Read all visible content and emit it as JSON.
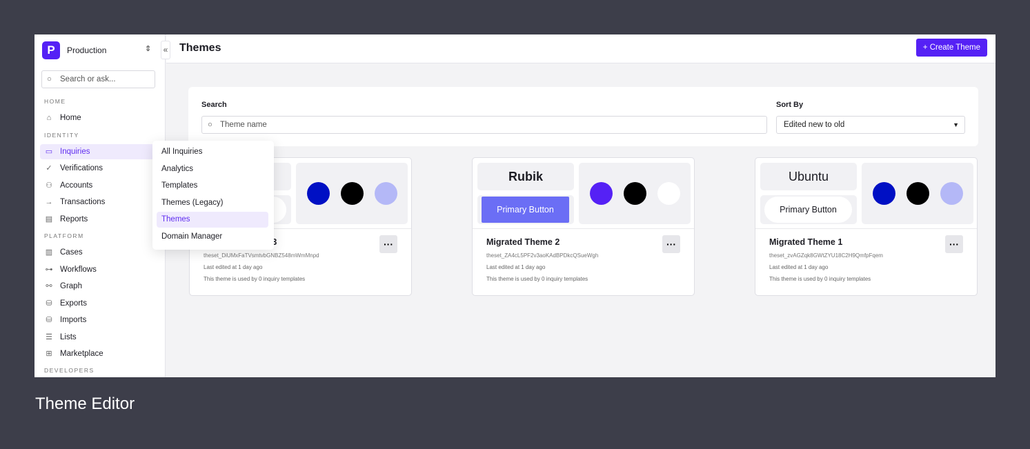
{
  "sidebar": {
    "org": "Production",
    "logo": "P",
    "search_placeholder": "Search or ask...",
    "sections": {
      "home": "HOME",
      "identity": "IDENTITY",
      "platform": "PLATFORM",
      "developers": "DEVELOPERS"
    },
    "items": [
      {
        "label": "Home",
        "icon": "home-icon"
      },
      {
        "label": "Inquiries",
        "icon": "id-card-icon"
      },
      {
        "label": "Verifications",
        "icon": "check-circle-icon"
      },
      {
        "label": "Accounts",
        "icon": "user-check-icon"
      },
      {
        "label": "Transactions",
        "icon": "arrow-right-icon"
      },
      {
        "label": "Reports",
        "icon": "document-icon"
      },
      {
        "label": "Cases",
        "icon": "briefcase-icon"
      },
      {
        "label": "Workflows",
        "icon": "workflow-icon"
      },
      {
        "label": "Graph",
        "icon": "graph-icon"
      },
      {
        "label": "Exports",
        "icon": "database-icon"
      },
      {
        "label": "Imports",
        "icon": "database-icon"
      },
      {
        "label": "Lists",
        "icon": "list-icon"
      },
      {
        "label": "Marketplace",
        "icon": "grid-icon"
      }
    ]
  },
  "submenu": [
    "All Inquiries",
    "Analytics",
    "Templates",
    "Themes (Legacy)",
    "Themes",
    "Domain Manager"
  ],
  "header": {
    "title": "Themes",
    "create_label": "Create Theme"
  },
  "filters": {
    "search_label": "Search",
    "search_placeholder": "Theme name",
    "sort_label": "Sort By",
    "sort_value": "Edited new to old"
  },
  "cards": [
    {
      "title": "Migrated Theme 3",
      "id": "theset_DiUMxFaTVsmtvbGNBZ548mWmMnpd",
      "edited": "Last edited at 1 day ago",
      "usage": "This theme is used by 0 inquiry templates",
      "font": "",
      "button": "",
      "colors": [
        "#0010c4",
        "#000000",
        "#b4b8f7"
      ]
    },
    {
      "title": "Migrated Theme 2",
      "id": "theset_ZA4cL5PF2v3aoKAdBPDkcQSueWgh",
      "edited": "Last edited at 1 day ago",
      "usage": "This theme is used by 0 inquiry templates",
      "font": "Rubik",
      "button": "Primary Button",
      "colors": [
        "#5521f5",
        "#000000",
        "#ffffff"
      ]
    },
    {
      "title": "Migrated Theme 1",
      "id": "theset_zvAGZqk8GWtZYU18C2H9QmfpFqem",
      "edited": "Last edited at 1 day ago",
      "usage": "This theme is used by 0 inquiry templates",
      "font": "Ubuntu",
      "button": "Primary Button",
      "colors": [
        "#0010c4",
        "#000000",
        "#b4b8f7"
      ]
    }
  ],
  "caption": "Theme Editor",
  "colors": {
    "accent": "#5521f5",
    "active_bg": "#efeafd"
  }
}
